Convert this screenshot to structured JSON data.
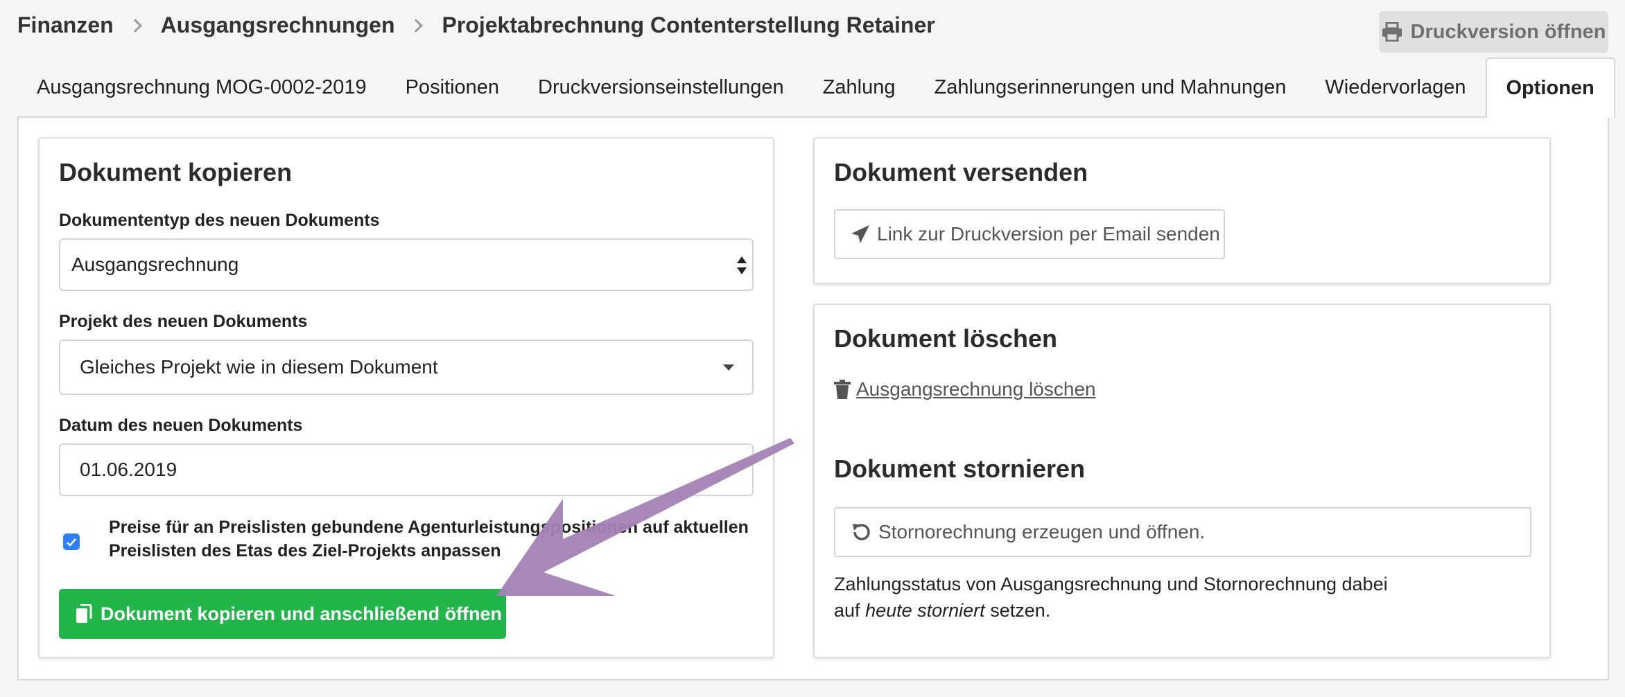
{
  "breadcrumb": {
    "item1": "Finanzen",
    "item2": "Ausgangsrechnungen",
    "item3": "Projektabrechnung Contenterstellung Retainer"
  },
  "header": {
    "print_button_label": "Druckversion öffnen"
  },
  "tabs": [
    {
      "label": "Ausgangsrechnung MOG-0002-2019"
    },
    {
      "label": "Positionen"
    },
    {
      "label": "Druckversionseinstellungen"
    },
    {
      "label": "Zahlung"
    },
    {
      "label": "Zahlungserinnerungen und Mahnungen"
    },
    {
      "label": "Wiedervorlagen"
    },
    {
      "label": "Optionen"
    }
  ],
  "copy_card": {
    "title": "Dokument kopieren",
    "doctype_label": "Dokumententyp des neuen Dokuments",
    "doctype_value": "Ausgangsrechnung",
    "project_label": "Projekt des neuen Dokuments",
    "project_value": "Gleiches Projekt wie in diesem Dokument",
    "date_label": "Datum des neuen Dokuments",
    "date_value": "01.06.2019",
    "checkbox_line1": "Preise für an Preislisten gebundene Agenturleistungspositionen auf aktuellen",
    "checkbox_line2": "Preislisten des Etas des Ziel-Projekts anpassen",
    "checkbox_checked": true,
    "submit_label": "Dokument kopieren und anschließend öffnen"
  },
  "send_card": {
    "title": "Dokument versenden",
    "button_label": "Link zur Druckversion per Email senden"
  },
  "delete_card": {
    "title": "Dokument löschen",
    "delete_link": "Ausgangsrechnung löschen",
    "cancel_title": "Dokument stornieren",
    "cancel_button": "Stornorechnung erzeugen und öffnen.",
    "note_line1": "Zahlungsstatus von Ausgangsrechnung und Stornorechnung dabei",
    "note_auf": "auf",
    "note_em": "heute storniert",
    "note_end": "setzen."
  },
  "colors": {
    "accent_green": "#21b54a",
    "checkbox_blue": "#2d7ff9",
    "annotation_arrow": "#a382b5"
  }
}
